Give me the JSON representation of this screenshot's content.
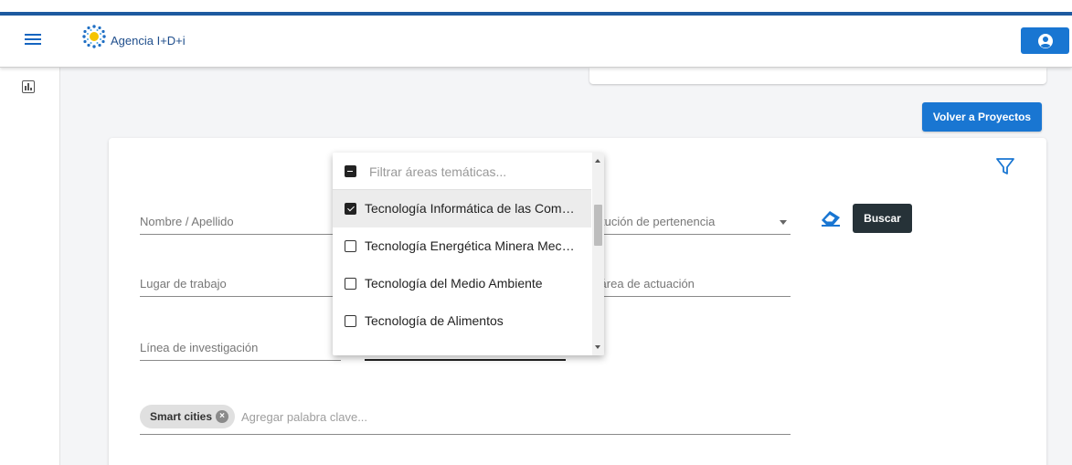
{
  "header": {
    "brand": "Agencia I+D+i",
    "menu_icon": "hamburger-menu-icon",
    "user_icon": "user-circle-icon",
    "accent": "#1e5aa0"
  },
  "sidebar": {
    "items": [
      {
        "icon": "chart-icon"
      }
    ]
  },
  "actions": {
    "volver_label": "Volver a Proyectos",
    "buscar_label": "Buscar",
    "clear_icon": "eraser-icon",
    "filter_icon": "filter-icon"
  },
  "form": {
    "nombre_placeholder": "Nombre / Apellido",
    "institucion_placeholder": "stitución de pertenencia",
    "lugar_placeholder": "Lugar de trabajo",
    "subarea_placeholder": "b-área de actuación",
    "linea_placeholder": "Línea de investigación",
    "keywords": {
      "chips": [
        "Smart cities"
      ],
      "placeholder": "Agregar palabra clave..."
    }
  },
  "areas_dropdown": {
    "filter_placeholder": "Filtrar áreas temáticas...",
    "options": [
      {
        "label": "Tecnología Informática de las Comunicaciones",
        "checked": true
      },
      {
        "label": "Tecnología Energética Minera Mecánica",
        "checked": false
      },
      {
        "label": "Tecnología del Medio Ambiente",
        "checked": false
      },
      {
        "label": "Tecnología de Alimentos",
        "checked": false
      }
    ]
  },
  "colors": {
    "primary_button": "#1976d2",
    "dark_button": "#263238",
    "chip_bg": "#e0e0e0"
  }
}
